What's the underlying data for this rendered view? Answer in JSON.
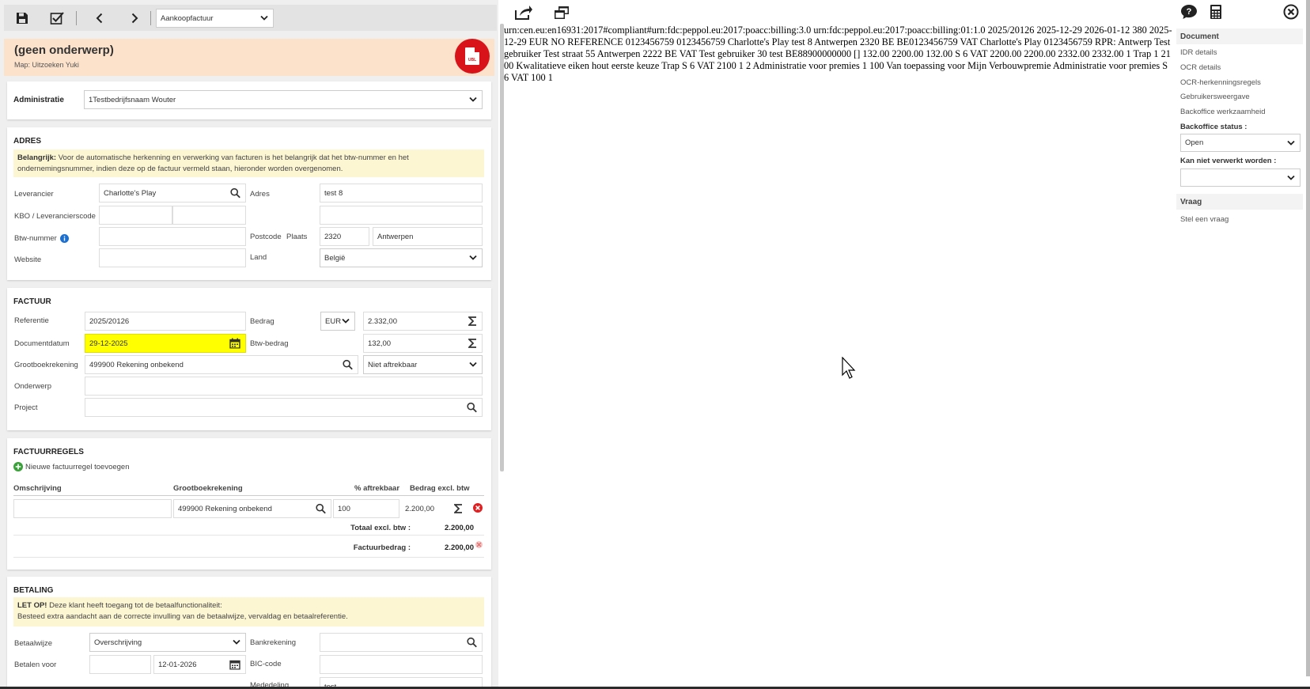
{
  "toolbar": {
    "doc_type": "Aankoopfactuur"
  },
  "header": {
    "title": "(geen onderwerp)",
    "subtitle": "Map: Uitzoeken Yuki",
    "badge": "UBL"
  },
  "administratie": {
    "label": "Administratie",
    "value": "1Testbedrijfsnaam Wouter"
  },
  "adres": {
    "title": "ADRES",
    "note_bold": "Belangrijk:",
    "note": "Voor de automatische herkenning en verwerking van facturen is het belangrijk dat het btw-nummer en het ondernemingsnummer, indien deze op de factuur vermeld staan, hieronder worden overgenomen.",
    "leverancier_label": "Leverancier",
    "leverancier_value": "Charlotte's Play",
    "adres_label": "Adres",
    "adres_value": "test 8",
    "kbo_label": "KBO / Leverancierscode",
    "btw_label": "Btw-nummer",
    "postcode_label": "Postcode",
    "plaats_label": "Plaats",
    "postcode_value": "2320",
    "plaats_value": "Antwerpen",
    "website_label": "Website",
    "land_label": "Land",
    "land_value": "België"
  },
  "factuur": {
    "title": "FACTUUR",
    "referentie_label": "Referentie",
    "referentie_value": "2025/20126",
    "bedrag_label": "Bedrag",
    "currency": "EUR",
    "bedrag_value": "2.332,00",
    "documentdatum_label": "Documentdatum",
    "documentdatum_value": "29-12-2025",
    "btwbedrag_label": "Btw-bedrag",
    "btwbedrag_value": "132,00",
    "grootboek_label": "Grootboekrekening",
    "grootboek_value": "499900 Rekening onbekend",
    "aftrek_value": "Niet aftrekbaar",
    "onderwerp_label": "Onderwerp",
    "project_label": "Project"
  },
  "regels": {
    "title": "FACTUURREGELS",
    "add_label": "Nieuwe factuurregel toevoegen",
    "col_omschrijving": "Omschrijving",
    "col_grootboek": "Grootboekrekening",
    "col_aftrek": "% aftrekbaar",
    "col_bedrag": "Bedrag excl. btw",
    "row": {
      "omschrijving": "",
      "grootboek": "499900 Rekening onbekend",
      "aftrek": "100",
      "bedrag": "2.200,00"
    },
    "totaal_label": "Totaal excl. btw :",
    "totaal_value": "2.200,00",
    "factuurbedrag_label": "Factuurbedrag :",
    "factuurbedrag_value": "2.200,00"
  },
  "betaling": {
    "title": "BETALING",
    "note_bold": "LET OP!",
    "note_line1": "Deze klant heeft toegang tot de betaalfunctionaliteit:",
    "note_line2": "Besteed extra aandacht aan de correcte invulling van de betaalwijze, vervaldag en betaalreferentie.",
    "betaalwijze_label": "Betaalwijze",
    "betaalwijze_value": "Overschrijving",
    "bankrekening_label": "Bankrekening",
    "betalenvoor_label": "Betalen voor",
    "betalenvoor_value": "12-01-2026",
    "bic_label": "BIC-code",
    "mededeling_label": "Mededeling",
    "mededeling_value": "test"
  },
  "document_text": "urn:cen.eu:en16931:2017#compliant#urn:fdc:peppol.eu:2017:poacc:billing:3.0 urn:fdc:peppol.eu:2017:poacc:billing:01:1.0 2025/20126 2025-12-29 2026-01-12 380 2025-12-29 EUR NO REFERENCE 0123456759 0123456759 Charlotte's Play test 8 Antwerpen 2320 BE BE0123456759 VAT Charlotte's Play 0123456759 RPR: Antwerp Test gebruiker Test straat 55 Antwerpen 2222 BE VAT Test gebruiker 30 test BE88900000000 [] 132.00 2200.00 132.00 S 6 VAT 2200.00 2200.00 2332.00 2332.00 1 Trap 1 2100 Kwalitatieve eiken hout eerste keuze Trap S 6 VAT 2100 1 2 Administratie voor premies 1 100 Van toepassing voor Mijn Verbouwpremie Administratie voor premies S 6 VAT 100 1",
  "right": {
    "document_title": "Document",
    "links": [
      "IDR details",
      "OCR details",
      "OCR-herkenningsregels",
      "Gebruikersweergave",
      "Backoffice werkzaamheid"
    ],
    "status_label": "Backoffice status :",
    "status_value": "Open",
    "kan_niet_label": "Kan niet verwerkt worden :",
    "kan_niet_value": "",
    "vraag_title": "Vraag",
    "vraag_link": "Stel een vraag"
  },
  "colors": {
    "highlight": "#ffff00",
    "header_bg": "#fde2cb",
    "note_bg": "#fdf6d3",
    "badge_red": "#d8131a",
    "add_green": "#3aa03a",
    "delete_red": "#e02020"
  },
  "icons": [
    "save-icon",
    "approve-icon",
    "arrow-left-icon",
    "arrow-right-icon",
    "share-icon",
    "windows-icon",
    "help-icon",
    "calculator-icon",
    "close-icon",
    "search-icon",
    "calendar-icon",
    "sigma-icon",
    "info-icon",
    "plus-circle-icon",
    "delete-icon"
  ]
}
